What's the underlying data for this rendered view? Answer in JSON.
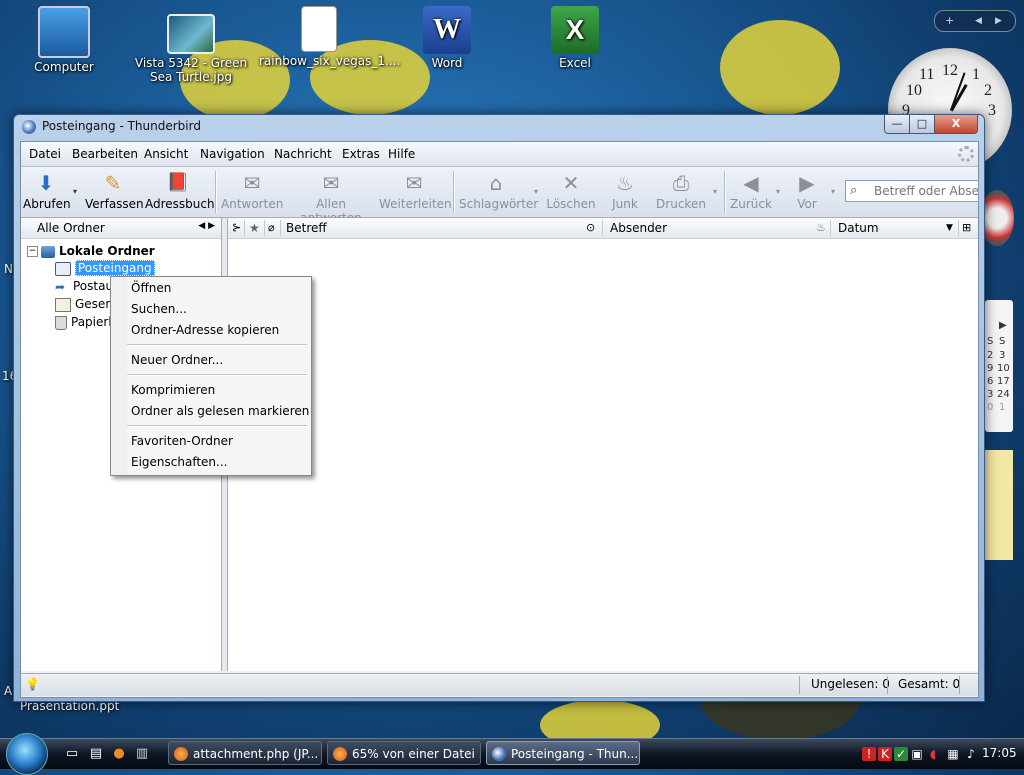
{
  "desktop": {
    "icons": [
      {
        "label": "Computer"
      },
      {
        "label": "Vista 5342 - Green Sea Turtle.jpg"
      },
      {
        "label": "rainbow_six_vegas_1...."
      },
      {
        "label": "Word"
      },
      {
        "label": "Excel"
      }
    ],
    "stray_labels": {
      "presentation": "Präsentation.ppt",
      "left_n": "N",
      "left_16": "16",
      "left_a": "A"
    },
    "sidebar": {
      "add": "+",
      "prev": "◀",
      "next": "▶",
      "calendar": {
        "rows": [
          [
            "",
            "▶"
          ],
          [
            "S",
            "S"
          ],
          [
            "2",
            "3"
          ],
          [
            "9",
            "10"
          ],
          [
            "6",
            "17"
          ],
          [
            "3",
            "24"
          ],
          [
            "0",
            "1"
          ]
        ]
      }
    },
    "clock_numbers": {
      "n12": "12",
      "n11": "11",
      "n10": "10",
      "n9": "9",
      "n1": "1",
      "n2": "2",
      "n3": "3"
    }
  },
  "window": {
    "title": "Posteingang - Thunderbird",
    "min_glyph": "—",
    "max_glyph": "□",
    "close_glyph": "X"
  },
  "menubar": {
    "items": [
      {
        "label": "Datei"
      },
      {
        "label": "Bearbeiten"
      },
      {
        "label": "Ansicht"
      },
      {
        "label": "Navigation"
      },
      {
        "label": "Nachricht"
      },
      {
        "label": "Extras"
      },
      {
        "label": "Hilfe"
      }
    ]
  },
  "toolbar": {
    "buttons": [
      {
        "label": "Abrufen",
        "icon": "⬇"
      },
      {
        "label": "Verfassen",
        "icon": "✎"
      },
      {
        "label": "Adressbuch",
        "icon": "📕"
      },
      {
        "label": "Antworten",
        "icon": "✉"
      },
      {
        "label": "Allen antworten",
        "icon": "✉"
      },
      {
        "label": "Weiterleiten",
        "icon": "✉"
      },
      {
        "label": "Schlagwörter",
        "icon": "⌂"
      },
      {
        "label": "Löschen",
        "icon": "✕"
      },
      {
        "label": "Junk",
        "icon": "♨"
      },
      {
        "label": "Drucken",
        "icon": "⎙"
      },
      {
        "label": "Zurück",
        "icon": "◀"
      },
      {
        "label": "Vor",
        "icon": "▶"
      }
    ],
    "dropdown_glyph": "▾",
    "search_placeholder": "Betreff oder Absender"
  },
  "folder_pane": {
    "header": "Alle Ordner",
    "arrows": "◀ ▶",
    "expander": "−",
    "root": "Lokale Ordner",
    "folders": [
      {
        "label": "Posteingang"
      },
      {
        "label": "Postausgang"
      },
      {
        "label": "Gesendet"
      },
      {
        "label": "Papierkorb"
      }
    ]
  },
  "thread_pane": {
    "columns": {
      "thread": "⊱",
      "star": "★",
      "attach": "⌀",
      "subject": "Betreff",
      "read": "⊙",
      "sender": "Absender",
      "junk": "♨",
      "date": "Datum",
      "sort": "▼",
      "picker": "⊞"
    }
  },
  "context_menu": {
    "items": [
      {
        "label": "Öffnen"
      },
      {
        "label": "Suchen..."
      },
      {
        "label": "Ordner-Adresse kopieren"
      },
      {
        "label": "Neuer Ordner..."
      },
      {
        "label": "Komprimieren"
      },
      {
        "label": "Ordner als gelesen markieren"
      },
      {
        "label": "Favoriten-Ordner"
      },
      {
        "label": "Eigenschaften..."
      }
    ]
  },
  "statusbar": {
    "unread": "Ungelesen: 0",
    "total": "Gesamt: 0"
  },
  "taskbar": {
    "tasks": [
      {
        "label": "attachment.php (JP..."
      },
      {
        "label": "65% von einer Datei ..."
      },
      {
        "label": "Posteingang - Thun..."
      }
    ],
    "time": "17:05"
  },
  "colors": {
    "selection": "#3399ff",
    "titlebar": "#b9d1ea",
    "taskbar": "#0d1624"
  }
}
